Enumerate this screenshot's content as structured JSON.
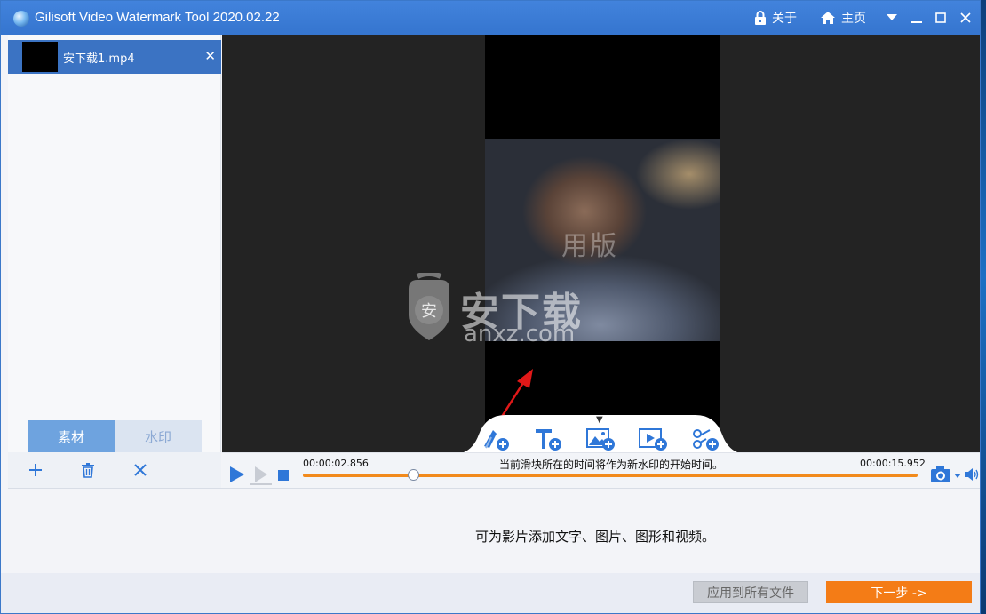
{
  "window": {
    "title": "Gilisoft Video Watermark Tool 2020.02.22",
    "about_label": "关于",
    "home_label": "主页"
  },
  "sidebar": {
    "file_name": "安下载1.mp4",
    "tabs": [
      {
        "label": "素材",
        "active": true
      },
      {
        "label": "水印",
        "active": false
      }
    ]
  },
  "preview": {
    "trial_watermark": "用版",
    "logo_text": "安下载",
    "logo_domain": "anxz.com",
    "logo_badge": "安"
  },
  "timeline": {
    "start_time": "00:00:02.856",
    "end_time": "00:00:15.952",
    "hint": "当前滑块所在的时间将作为新水印的开始时间。",
    "slider_position": 0.18
  },
  "info": {
    "message": "可为影片添加文字、图片、图形和视频。"
  },
  "footer": {
    "apply_all_label": "应用到所有文件",
    "next_label": "下一步 ->"
  },
  "colors": {
    "title_bar": "#3a7bd5",
    "accent_orange": "#f47c16",
    "tab_active": "#6ea3df",
    "icon_blue": "#2f77d8"
  }
}
